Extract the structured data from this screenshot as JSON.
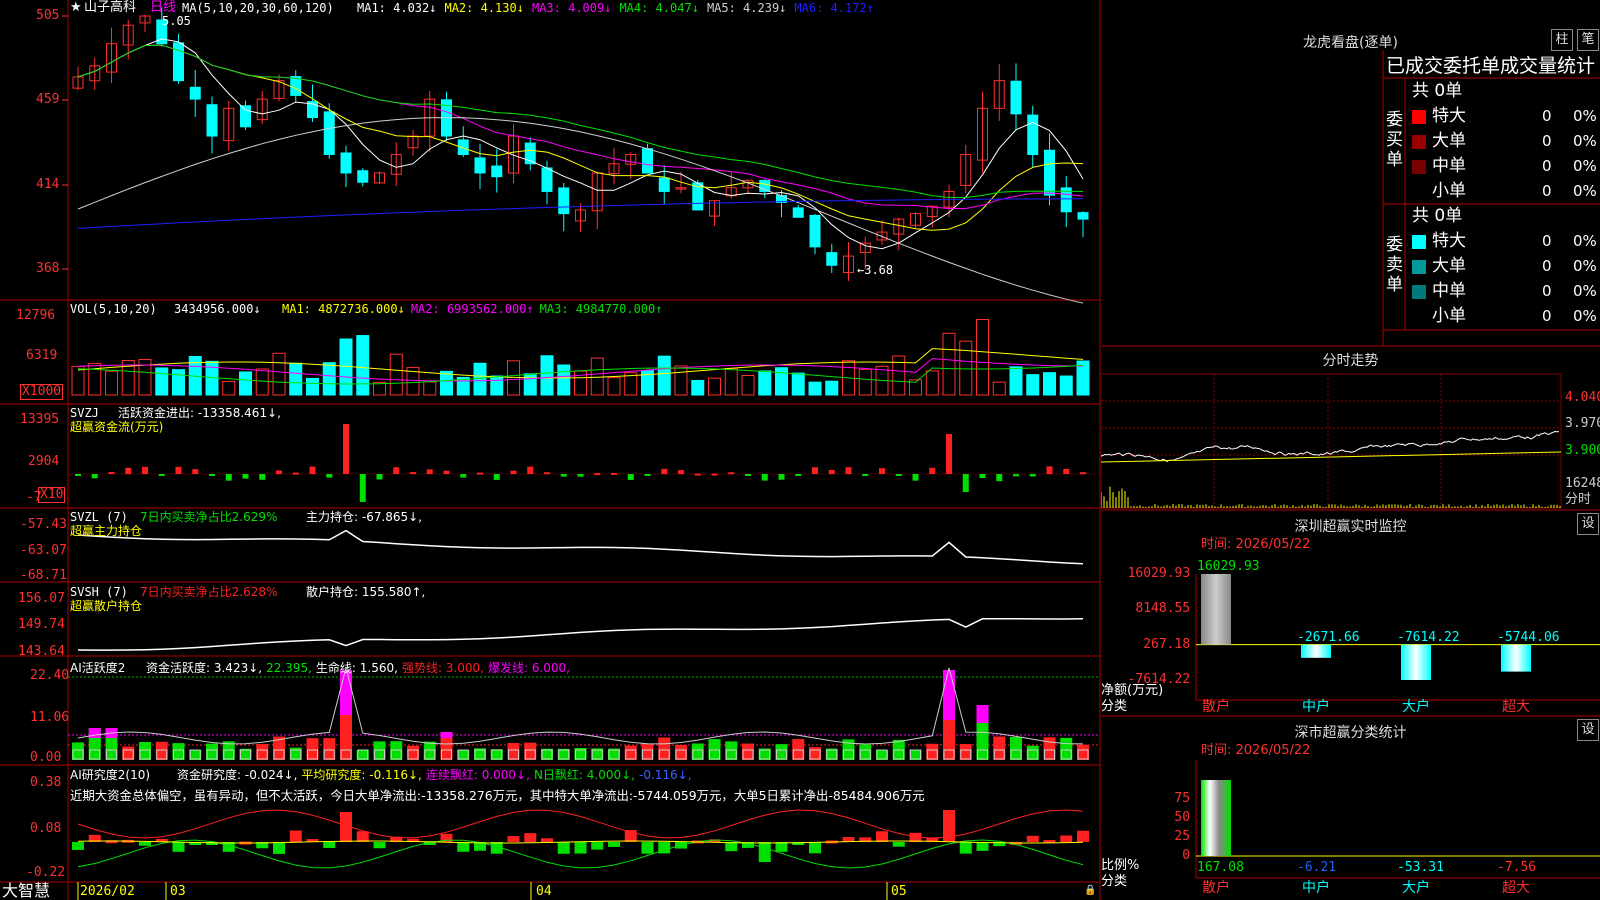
{
  "stock": {
    "star": "★",
    "name": "山子高科",
    "period": "日线"
  },
  "main_panel": {
    "ma_label": "MA(5,10,20,30,60,120)",
    "ma": [
      {
        "label": "MA1: 4.032↓",
        "color": "#ffffff"
      },
      {
        "label": "MA2: 4.130↓",
        "color": "#ffff00"
      },
      {
        "label": "MA3: 4.009↓",
        "color": "#ff00ff"
      },
      {
        "label": "MA4: 4.047↓",
        "color": "#00e000"
      },
      {
        "label": "MA5: 4.239↓",
        "color": "#d0d0d0"
      },
      {
        "label": "MA6: 4.172↑",
        "color": "#2020ff"
      }
    ],
    "high_note": "5.05",
    "low_note": "←3.68",
    "y_ticks": [
      "505",
      "459",
      "414",
      "368"
    ]
  },
  "vol_panel": {
    "label": "VOL(5,10,20)",
    "value": "3434956.000↓",
    "ma": [
      {
        "label": "MA1: 4872736.000↓",
        "color": "#ffff00"
      },
      {
        "label": "MA2: 6993562.000↑",
        "color": "#ff00ff"
      },
      {
        "label": "MA3: 4984770.000↑",
        "color": "#00e000"
      }
    ],
    "y_ticks": [
      "12796",
      "6319"
    ],
    "unit": "X1000"
  },
  "svzj_panel": {
    "label": "SVZJ",
    "text": "活跃资金进出: -13358.461↓,",
    "subtitle": "超赢资金流(万元)",
    "y_ticks": [
      "13395",
      "2904",
      "-7"
    ],
    "unit": "X10"
  },
  "svzl_panel": {
    "label": "SVZL (7)",
    "ratio": "7日内买卖净占比2.629%",
    "hold": "主力持仓: -67.865↓,",
    "subtitle": "超赢主力持仓",
    "y_ticks": [
      "-57.43",
      "-63.07",
      "-68.71"
    ]
  },
  "svsh_panel": {
    "label": "SVSH (7)",
    "ratio": "7日内买卖净占比2.628%",
    "hold": "散户持仓: 155.580↑,",
    "subtitle": "超赢散户持仓",
    "y_ticks": [
      "156.07",
      "149.74",
      "143.64"
    ]
  },
  "ai_active_panel": {
    "label": "AI活跃度2",
    "parts": [
      {
        "text": "资金活跃度: 3.423↓,",
        "color": "#ffffff"
      },
      {
        "text": "22.395,",
        "color": "#00e000"
      },
      {
        "text": "生命线: 1.560,",
        "color": "#ffffff"
      },
      {
        "text": "强势线: 3.000,",
        "color": "#ff2020"
      },
      {
        "text": "爆发线: 6.000,",
        "color": "#ff00ff"
      }
    ],
    "y_ticks": [
      "22.40",
      "11.06",
      "0.00"
    ]
  },
  "ai_research_panel": {
    "label": "AI研究度2(10)",
    "parts": [
      {
        "text": "资金研究度: -0.024↓,",
        "color": "#ffffff"
      },
      {
        "text": "平均研究度: -0.116↓,",
        "color": "#ffff00"
      },
      {
        "text": "连续飘红: 0.000↓,",
        "color": "#ff00ff"
      },
      {
        "text": "N日飘红: 4.000↓,",
        "color": "#00e000"
      },
      {
        "text": "-0.116↓,",
        "color": "#4060ff"
      }
    ],
    "commentary": "近期大资金总体偏空，虽有异动，但不太活跃，今日大单净流出:-13358.276万元，其中特大单净流出:-5744.059万元，大单5日累计净出-85484.906万元",
    "y_ticks": [
      "0.38",
      "0.08",
      "-0.22"
    ]
  },
  "x_axis": {
    "brand": "大智慧",
    "labels": [
      "2026/02",
      "03",
      "04",
      "05"
    ]
  },
  "dragon_panel": {
    "title": "龙虎看盘(逐单)",
    "btn_bar": "柱",
    "btn_pen": "笔",
    "header": "已成交委托单成交量统计",
    "buy": {
      "side_label": "委买单",
      "total": "共 0单",
      "rows": [
        {
          "name": "特大",
          "count": "0",
          "pct": "0%",
          "color": "#ff0000"
        },
        {
          "name": "大单",
          "count": "0",
          "pct": "0%",
          "color": "#9a0000"
        },
        {
          "name": "中单",
          "count": "0",
          "pct": "0%",
          "color": "#7a0000"
        },
        {
          "name": "小单",
          "count": "0",
          "pct": "0%",
          "color": ""
        }
      ]
    },
    "sell": {
      "side_label": "委卖单",
      "total": "共 0单",
      "rows": [
        {
          "name": "特大",
          "count": "0",
          "pct": "0%",
          "color": "#00ffff"
        },
        {
          "name": "大单",
          "count": "0",
          "pct": "0%",
          "color": "#009a9a"
        },
        {
          "name": "中单",
          "count": "0",
          "pct": "0%",
          "color": "#007a7a"
        },
        {
          "name": "小单",
          "count": "0",
          "pct": "0%",
          "color": ""
        }
      ]
    }
  },
  "intraday_panel": {
    "title": "分时走势",
    "y_labels": [
      "4.040",
      "3.970",
      "3.900"
    ],
    "vol_label": "16248",
    "unit_label": "分时"
  },
  "sz_monitor": {
    "title": "深圳超赢实时监控",
    "settings": "设",
    "time": "时间: 2026/05/22",
    "y_ticks": [
      "16029.93",
      "8148.55",
      "267.18",
      "-7614.22"
    ],
    "y_label": "净额(万元)",
    "x_label": "分类",
    "bars": [
      {
        "category": "散户",
        "value": 16029.93,
        "label": "16029.93"
      },
      {
        "category": "中户",
        "value": -2671.66,
        "label": "-2671.66"
      },
      {
        "category": "大户",
        "value": -7614.22,
        "label": "-7614.22"
      },
      {
        "category": "超大",
        "value": -5744.06,
        "label": "-5744.06"
      }
    ]
  },
  "sz_class": {
    "title": "深市超赢分类统计",
    "settings": "设",
    "time": "时间: 2026/05/22",
    "y_ticks": [
      "75",
      "50",
      "25",
      "0"
    ],
    "y_label": "比例%",
    "x_label": "分类",
    "bars": [
      {
        "category": "散户",
        "value": 167.08,
        "label": "167.08"
      },
      {
        "category": "中户",
        "value": -6.21,
        "label": "-6.21"
      },
      {
        "category": "大户",
        "value": -53.31,
        "label": "-53.31"
      },
      {
        "category": "超大",
        "value": -7.56,
        "label": "-7.56"
      }
    ]
  },
  "chart_data": [
    {
      "type": "bar",
      "title": "深圳超赢实时监控",
      "ylabel": "净额(万元)",
      "xlabel": "分类",
      "categories": [
        "散户",
        "中户",
        "大户",
        "超大"
      ],
      "values": [
        16029.93,
        -2671.66,
        -7614.22,
        -5744.06
      ],
      "ylim": [
        -7614.22,
        16029.93
      ]
    },
    {
      "type": "bar",
      "title": "深市超赢分类统计",
      "ylabel": "比例%",
      "xlabel": "分类",
      "categories": [
        "散户",
        "中户",
        "大户",
        "超大"
      ],
      "values": [
        167.08,
        -6.21,
        -53.31,
        -7.56
      ],
      "ylim": [
        0,
        75
      ]
    }
  ]
}
